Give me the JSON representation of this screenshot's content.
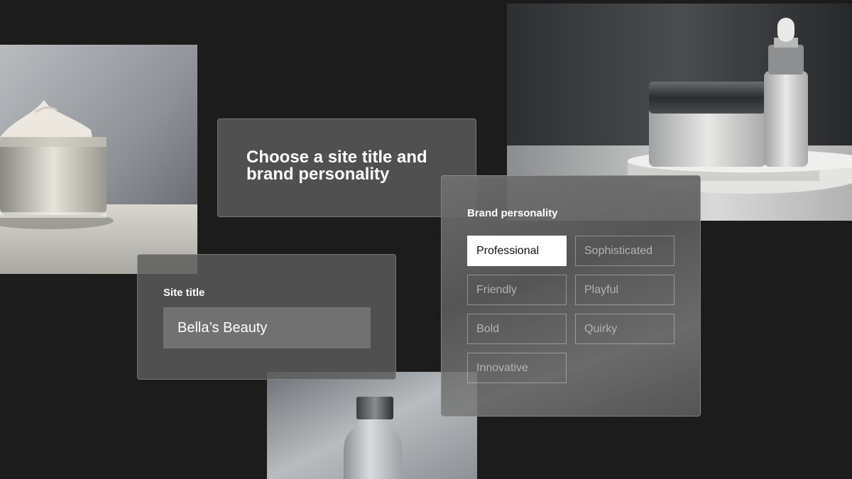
{
  "headline": "Choose a site title and brand personality",
  "site_title": {
    "label": "Site title",
    "value": "Bella’s Beauty"
  },
  "brand_personality": {
    "title": "Brand personality",
    "selected": "Professional",
    "options": [
      "Professional",
      "Sophisticated",
      "Friendly",
      "Playful",
      "Bold",
      "Quirky",
      "Innovative"
    ]
  },
  "colors": {
    "background": "#1c1c1c",
    "card": "#5c5c5c",
    "input": "#717171",
    "selected_chip": "#ffffff"
  }
}
